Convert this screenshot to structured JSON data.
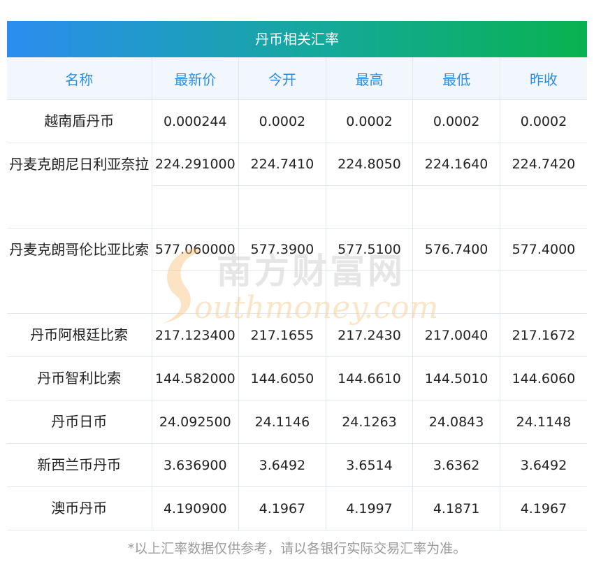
{
  "title": "丹币相关汇率",
  "columns": [
    "名称",
    "最新价",
    "今开",
    "最高",
    "最低",
    "昨收"
  ],
  "rows": [
    {
      "name": "越南盾丹币",
      "values": [
        "0.000244",
        "0.0002",
        "0.0002",
        "0.0002",
        "0.0002"
      ]
    },
    {
      "name": "丹麦克朗尼日利亚奈拉",
      "values": [
        "224.291000",
        "224.7410",
        "224.8050",
        "224.1640",
        "224.7420"
      ]
    },
    {
      "name": "丹麦克朗哥伦比亚比索",
      "values": [
        "577.060000",
        "577.3900",
        "577.5100",
        "576.7400",
        "577.4000"
      ]
    },
    {
      "name": "丹币阿根廷比索",
      "values": [
        "217.123400",
        "217.1655",
        "217.2430",
        "217.0040",
        "217.1672"
      ]
    },
    {
      "name": "丹币智利比索",
      "values": [
        "144.582000",
        "144.6050",
        "144.6610",
        "144.5010",
        "144.6060"
      ]
    },
    {
      "name": "丹币日币",
      "values": [
        "24.092500",
        "24.1146",
        "24.1263",
        "24.0843",
        "24.1148"
      ]
    },
    {
      "name": "新西兰币丹币",
      "values": [
        "3.636900",
        "3.6492",
        "3.6514",
        "3.6362",
        "3.6492"
      ]
    },
    {
      "name": "澳币丹币",
      "values": [
        "4.190900",
        "4.1967",
        "4.1997",
        "4.1871",
        "4.1967"
      ]
    }
  ],
  "watermark": {
    "cn": "南方财富网",
    "en": "outhmoney.com"
  },
  "note": "*以上汇率数据仅供参考，请以各银行实际交易汇率为准。",
  "colors": {
    "header_text": "#2e8ce0",
    "banner_start": "#2b8df0",
    "banner_end": "#09b24f"
  }
}
